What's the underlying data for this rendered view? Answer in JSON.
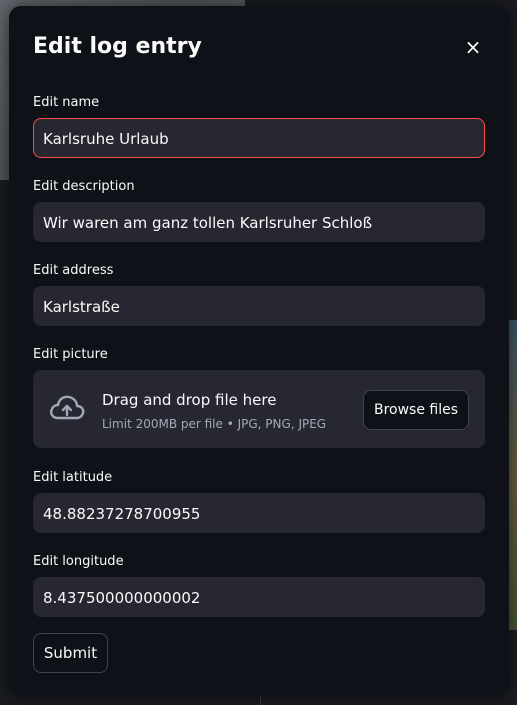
{
  "modal": {
    "title": "Edit log entry",
    "close_icon": "×"
  },
  "fields": {
    "name": {
      "label": "Edit name",
      "value": "Karlsruhe Urlaub"
    },
    "description": {
      "label": "Edit description",
      "value": "Wir waren am ganz tollen Karlsruher Schloß"
    },
    "address": {
      "label": "Edit address",
      "value": "Karlstraße"
    },
    "picture": {
      "label": "Edit picture",
      "drop_text": "Drag and drop file here",
      "limit_text": "Limit 200MB per file • JPG, PNG, JPEG",
      "browse_label": "Browse files",
      "icon": "cloud-upload-icon"
    },
    "latitude": {
      "label": "Edit latitude",
      "value": "48.88237278700955"
    },
    "longitude": {
      "label": "Edit longitude",
      "value": "8.437500000000002"
    }
  },
  "submit_label": "Submit",
  "colors": {
    "background": "#0e1117",
    "input_bg": "#262730",
    "focus_border": "#ff4b4b",
    "text": "#fafafa",
    "muted_text": "#a3a8b8"
  }
}
